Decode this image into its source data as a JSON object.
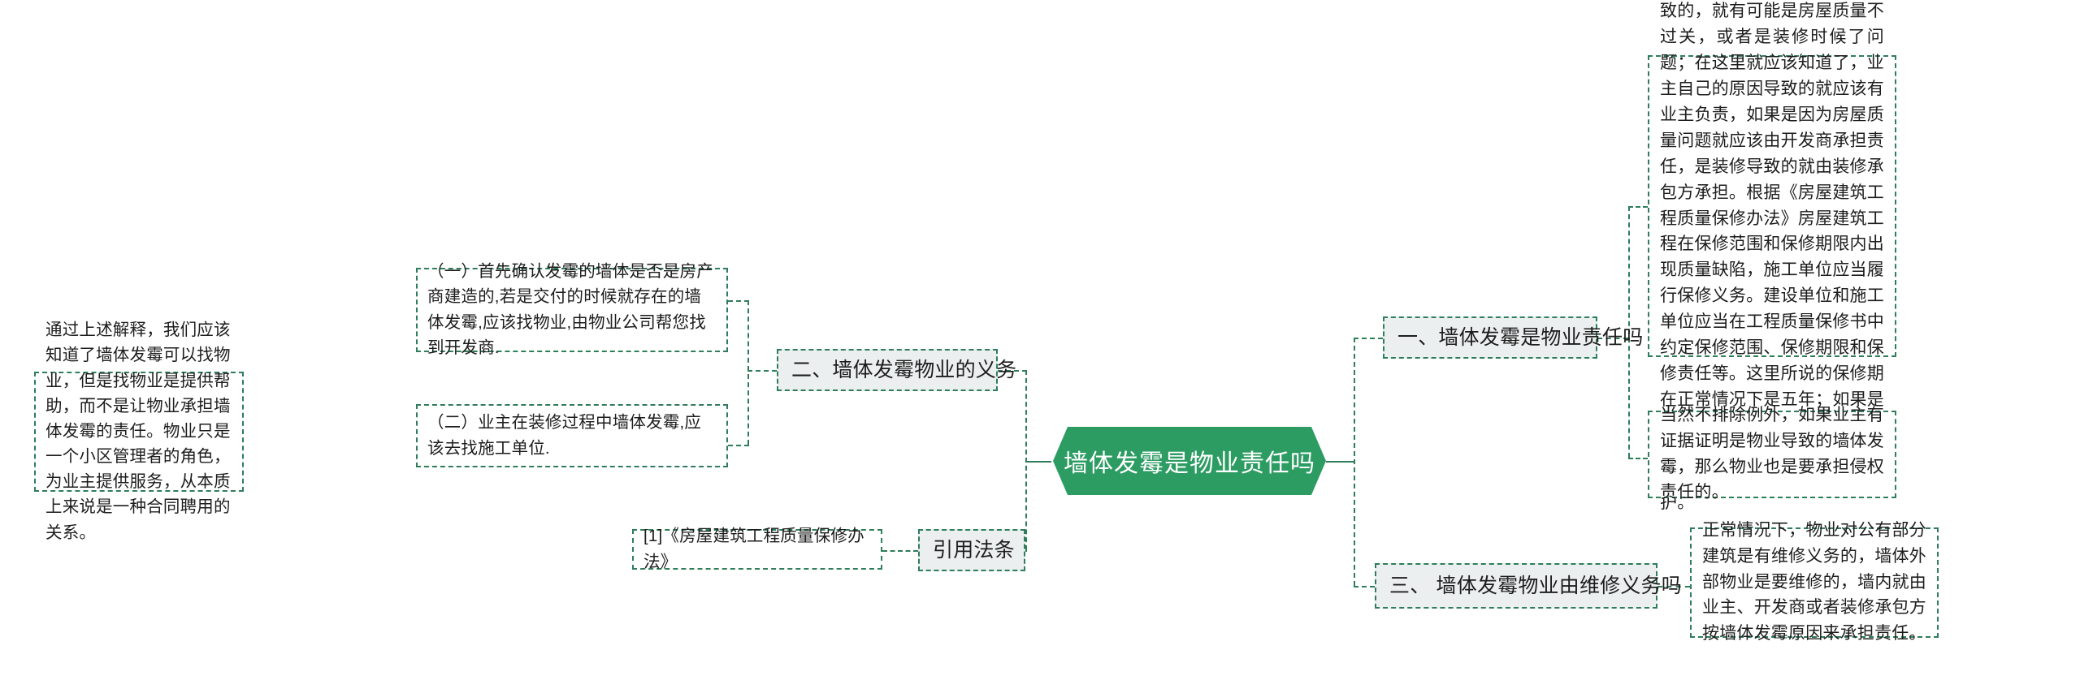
{
  "theme": {
    "accent_green": "#2e7d5b",
    "root_fill": "#2d9c63",
    "topic_fill": "#eceff0",
    "text_color": "#1d1d1d"
  },
  "mindmap": {
    "root": {
      "label": "墙体发霉是物业责任吗"
    },
    "right_branches": [
      {
        "id": "branch-1",
        "label": "一、墙体发霉是物业责任吗",
        "details": [
          {
            "id": "detail-1-1",
            "text": "一般来说，墙体发霉不是物业责任，住宅里面是业主专有部分，只有业主在使用，那么墙体发霉，如果不是业主自己导致的，就有可能是房屋质量不过关，或者是装修时候了问题；在这里就应该知道了，业主自己的原因导致的就应该有业主负责，如果是因为房屋质量问题就应该由开发商承担责任，是装修导致的就由装修承包方承担。根据《房屋建筑工程质量保修办法》房屋建筑工程在保修范围和保修期限内出现质量缺陷，施工单位应当履行保修义务。建设单位和施工单位应当在工程质量保修书中约定保修范围、保修期限和保修责任等。这里所说的保修期在正常情况下是五年；如果是因为业主使用不当、第三方人为损坏或者不可抗力因素导致的，就不受最低保修年限的保护。"
          },
          {
            "id": "detail-1-2",
            "text": "当然不排除例外，如果业主有证据证明是物业导致的墙体发霉，那么物业也是要承担侵权责任的。"
          }
        ]
      },
      {
        "id": "branch-3",
        "label": "三、 墙体发霉物业由维修义务吗",
        "details": [
          {
            "id": "detail-3-1",
            "text": "正常情况下，物业对公有部分建筑是有维修义务的，墙体外部物业是要维修的，墙内就由业主、开发商或者装修承包方按墙体发霉原因来承担责任。"
          }
        ]
      }
    ],
    "left_branches": [
      {
        "id": "branch-2",
        "label": "二、墙体发霉物业的义务",
        "details": [
          {
            "id": "detail-2-1",
            "text": "（一）首先确认发霉的墙体是否是房产商建造的,若是交付的时候就存在的墙体发霉,应该找物业,由物业公司帮您找到开发商."
          },
          {
            "id": "detail-2-2",
            "text": "（二）业主在装修过程中墙体发霉,应该去找施工单位."
          }
        ]
      },
      {
        "id": "branch-ref",
        "label": "引用法条",
        "details": [
          {
            "id": "detail-ref-1",
            "text": "[1]《房屋建筑工程质量保修办法》"
          }
        ]
      }
    ],
    "far_left_note": {
      "id": "note-summary",
      "text": "通过上述解释，我们应该知道了墙体发霉可以找物业，但是找物业是提供帮助，而不是让物业承担墙体发霉的责任。物业只是一个小区管理者的角色，为业主提供服务，从本质上来说是一种合同聘用的关系。"
    }
  }
}
